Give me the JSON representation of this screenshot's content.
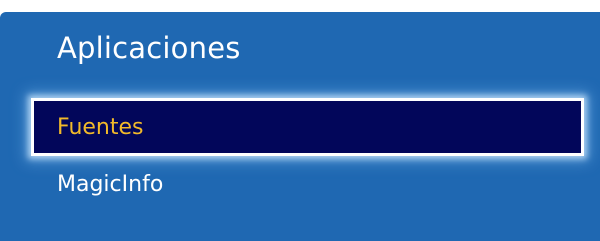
{
  "colors": {
    "panel_background": "#1f68b2",
    "selected_background": "#02065a",
    "selected_text": "#f2ba2a",
    "text": "#ffffff"
  },
  "menu": {
    "title": "Aplicaciones",
    "items": [
      {
        "label": "Fuentes",
        "selected": true
      },
      {
        "label": "MagicInfo",
        "selected": false
      }
    ]
  }
}
